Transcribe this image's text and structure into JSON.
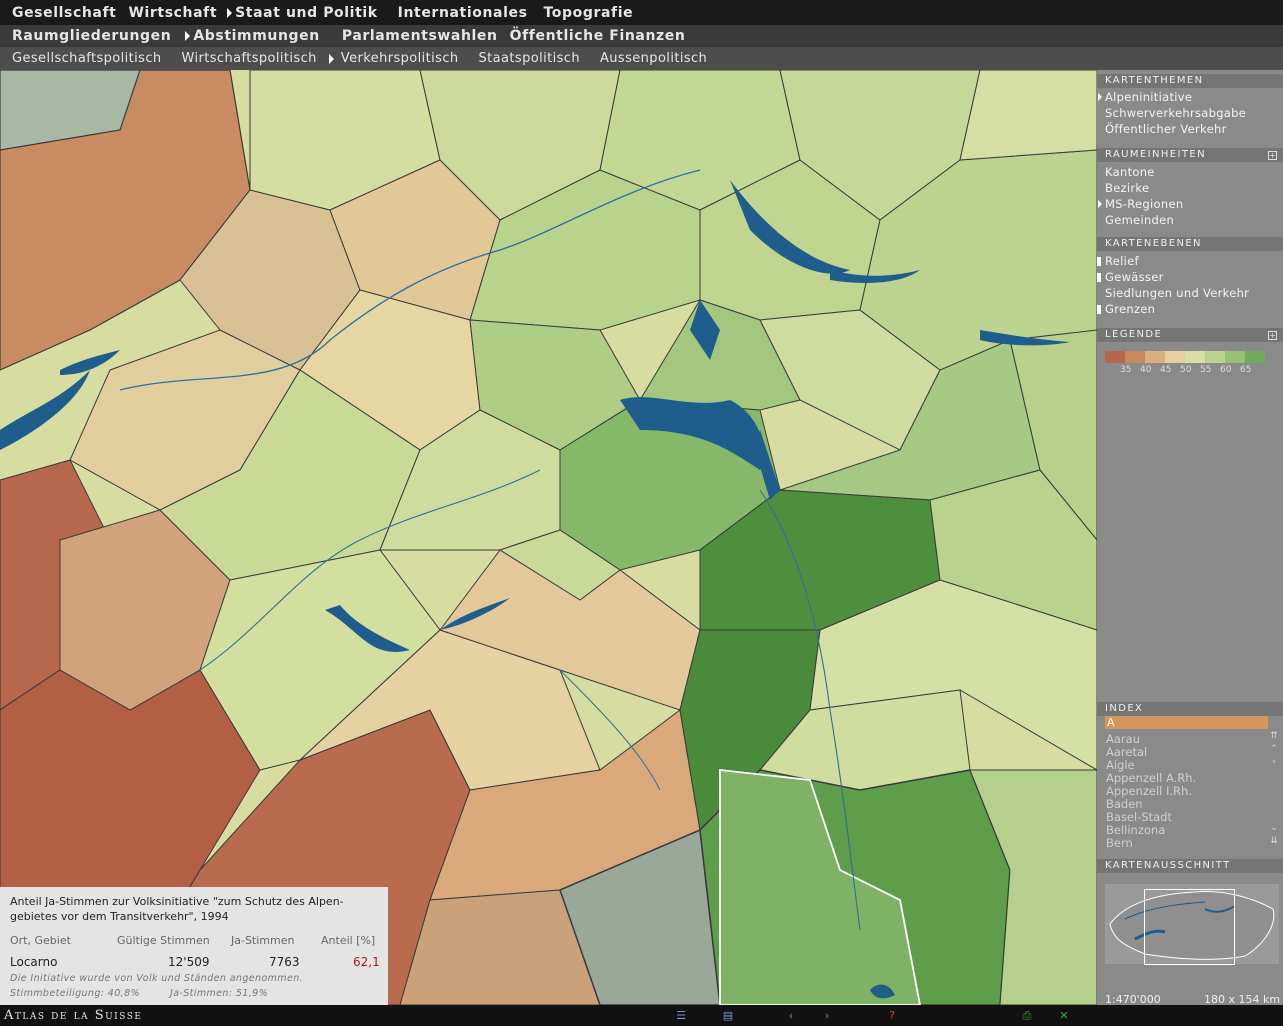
{
  "menu1": [
    "Gesellschaft",
    "Wirtschaft",
    "Staat und Politik",
    "Internationales",
    "Topografie"
  ],
  "menu2": [
    "Raumgliederungen",
    "Abstimmungen",
    "Parlamentswahlen",
    "Öffentliche Finanzen"
  ],
  "menu3": [
    "Gesellschaftspolitisch",
    "Wirtschaftspolitisch",
    "Verkehrspolitisch",
    "Staatspolitisch",
    "Aussenpolitisch"
  ],
  "panel": {
    "themes_title": "KARTENTHEMEN",
    "themes": [
      "Alpeninitiative",
      "Schwerverkehrsabgabe",
      "Öffentlicher Verkehr"
    ],
    "units_title": "RAUMEINHEITEN",
    "units": [
      "Kantone",
      "Bezirke",
      "MS-Regionen",
      "Gemeinden"
    ],
    "layers_title": "KARTENEBENEN",
    "layers": [
      "Relief",
      "Gewässer",
      "Siedlungen und Verkehr",
      "Grenzen"
    ],
    "legend_title": "LEGENDE",
    "legend_colors": [
      "#b5674b",
      "#c78a5e",
      "#d9ae80",
      "#e6cf9c",
      "#d9dfa4",
      "#bcd38d",
      "#98c173",
      "#73aa5a"
    ],
    "legend_labels": [
      "35",
      "40",
      "45",
      "50",
      "55",
      "60",
      "65"
    ],
    "index_title": "INDEX",
    "index_selected": "A",
    "index_items": [
      "Aarau",
      "Aaretal",
      "Aigle",
      "Appenzell A.Rh.",
      "Appenzell I.Rh.",
      "Baden",
      "Basel-Stadt",
      "Bellinzona",
      "Bern"
    ],
    "extract_title": "KARTENAUSSCHNITT",
    "scale": "1:470'000",
    "size": "180 x 154 km"
  },
  "info": {
    "title_line1": "Anteil Ja-Stimmen zur Volksinitiative \"zum Schutz des Alpen-",
    "title_line2": "gebietes vor dem Transitverkehr\", 1994",
    "headers": [
      "Ort, Gebiet",
      "Gültige Stimmen",
      "Ja-Stimmen",
      "Anteil [%]"
    ],
    "row": {
      "place": "Locarno",
      "valid": "12'509",
      "yes": "7763",
      "share": "62,1"
    },
    "note1": "Die Initiative wurde von Volk und Ständen angenommen.",
    "note2_a": "Stimmbeteiligung: 40,8%",
    "note2_b": "Ja-Stimmen: 51,9%"
  },
  "brand": "Atlas de la Suisse",
  "colors": {
    "menu_dark": "#1a1a1a",
    "panel": "#8a8a8a",
    "lake": "#1f5e8c",
    "highlight": "#d4965a",
    "red_value": "#b71818"
  }
}
